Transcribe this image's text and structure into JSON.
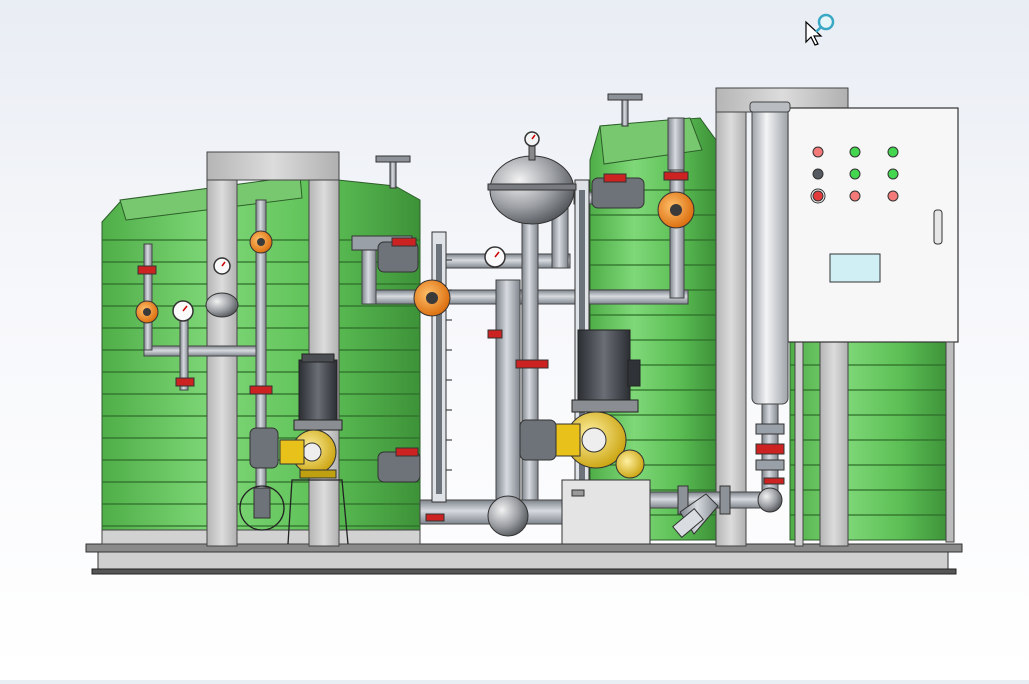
{
  "viewport": {
    "background_top": "#e9edf4",
    "background_bottom": "#ffffff"
  },
  "cursor": {
    "icon": "arrow-cursor-with-magnifier-icon"
  },
  "colors": {
    "tank_green": "#66c75e",
    "tank_green_dark": "#3f8f3a",
    "frame_gray": "#c9c9c9",
    "pipe_gray": "#9aa0a8",
    "valve_orange": "#e8801a",
    "valve_red": "#cc2222",
    "pump_yellow": "#e8c21a",
    "motor_dark": "#3a3d42",
    "panel_white": "#f6f6f6",
    "indicator_red": "#f25c5c",
    "indicator_green": "#3fd24a",
    "indicator_dark": "#555a60"
  },
  "control_panel": {
    "indicator_lights": [
      {
        "color": "#f47a7a"
      },
      {
        "color": "#45d64f"
      },
      {
        "color": "#45d64f"
      },
      {
        "color": "#555a60"
      },
      {
        "color": "#45d64f"
      },
      {
        "color": "#45d64f"
      },
      {
        "color": "#e33b3b"
      },
      {
        "color": "#f47a7a"
      },
      {
        "color": "#f47a7a"
      }
    ],
    "display_color": "#cfeff4"
  }
}
